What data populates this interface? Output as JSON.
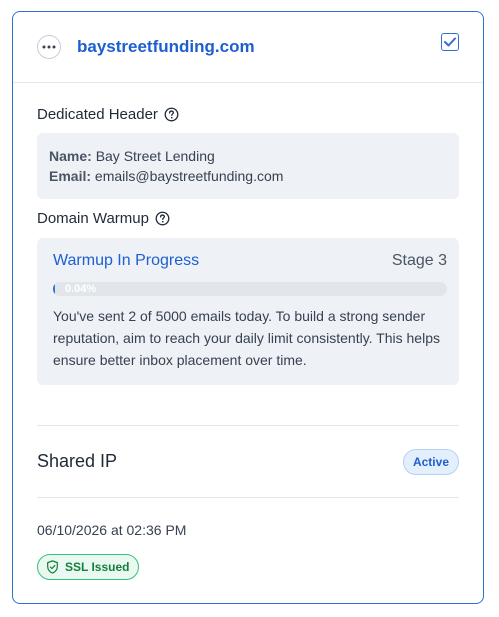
{
  "header": {
    "domain": "baystreetfunding.com"
  },
  "dedicated_header": {
    "title": "Dedicated Header",
    "name_label": "Name:",
    "name_value": "Bay Street Lending",
    "email_label": "Email:",
    "email_value": "emails@baystreetfunding.com"
  },
  "warmup": {
    "title": "Domain Warmup",
    "status": "Warmup In Progress",
    "stage": "Stage 3",
    "progress_text": "0.04%",
    "progress_fraction": 0.0004,
    "description": "You've sent 2 of 5000 emails today. To build a strong sender reputation, aim to reach your daily limit consistently. This helps ensure better inbox placement over time."
  },
  "shared_ip": {
    "label": "Shared IP",
    "badge": "Active"
  },
  "footer": {
    "timestamp": "06/10/2026 at 02:36 PM",
    "ssl_badge": "SSL Issued"
  },
  "colors": {
    "accent": "#1d5fd1",
    "success": "#15803d"
  }
}
